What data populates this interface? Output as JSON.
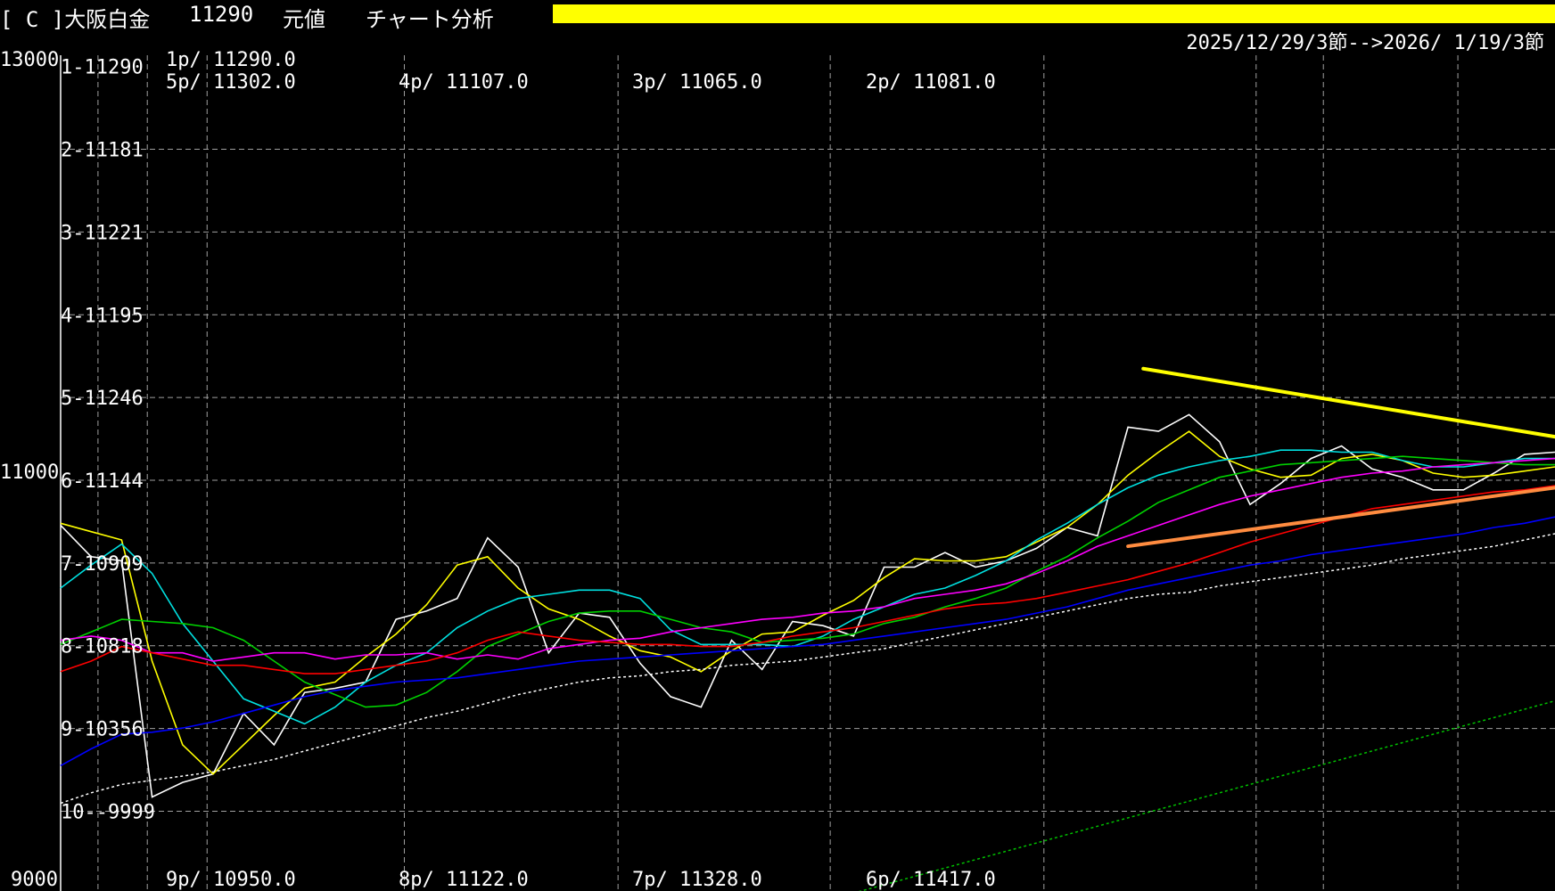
{
  "header": {
    "symbol": "[ C ]大阪白金",
    "price": "11290",
    "price_type": "元値",
    "mode": "チャート分析",
    "date_range": "2025/12/29/3節-->2026/ 1/19/3節"
  },
  "colors": {
    "background": "#000000",
    "header_bar": "#ffff00",
    "grid": "#a0a0a0",
    "resistance_line": "#ffff00",
    "support_line": "#ff8c40"
  },
  "chart_data": {
    "type": "line",
    "y_axis_labels": [
      "13000",
      "11000",
      "9000"
    ],
    "ylim": [
      9000,
      13000
    ],
    "grid": true,
    "row_labels": [
      "1-11290",
      "2-11181",
      "3-11221",
      "4-11195",
      "5-11246",
      "6-11144",
      "7-10909",
      "8-10818",
      "9-10356",
      "10--9999"
    ],
    "period_labels": {
      "top_row1": [
        "1p/ 11290.0"
      ],
      "top_row2": [
        "5p/ 11302.0",
        "4p/ 11107.0",
        "3p/ 11065.0",
        "2p/ 11081.0"
      ],
      "bottom": [
        "9p/ 10950.0",
        "8p/ 11122.0",
        "7p/ 11328.0",
        "6p/ 11417.0"
      ]
    },
    "x_index": [
      0,
      1,
      2,
      3,
      4,
      5,
      6,
      7,
      8,
      9,
      10,
      11,
      12,
      13,
      14,
      15,
      16,
      17,
      18,
      19,
      20,
      21,
      22,
      23,
      24,
      25,
      26,
      27,
      28,
      29,
      30,
      31,
      32,
      33,
      34,
      35,
      36,
      37,
      38,
      39,
      40,
      41,
      42,
      43,
      44,
      45,
      46,
      47,
      48,
      49
    ],
    "series": [
      {
        "color": "#ffffff",
        "style": "solid",
        "values": [
          10750,
          10600,
          10580,
          9450,
          9520,
          9560,
          9850,
          9700,
          9950,
          9970,
          10000,
          10300,
          10340,
          10400,
          10690,
          10550,
          10140,
          10330,
          10310,
          10090,
          9930,
          9880,
          10200,
          10060,
          10290,
          10270,
          10220,
          10550,
          10550,
          10620,
          10550,
          10580,
          10640,
          10740,
          10700,
          11220,
          11200,
          11280,
          11150,
          10850,
          10950,
          11070,
          11130,
          11020,
          10980,
          10920,
          10920,
          11000,
          11090,
          11100
        ]
      },
      {
        "color": "#ffff00",
        "style": "solid",
        "values": [
          10760,
          10720,
          10680,
          10100,
          9700,
          9560,
          9700,
          9840,
          9970,
          10000,
          10120,
          10230,
          10370,
          10560,
          10600,
          10450,
          10350,
          10300,
          10220,
          10150,
          10120,
          10050,
          10150,
          10230,
          10240,
          10320,
          10390,
          10500,
          10590,
          10580,
          10580,
          10600,
          10670,
          10740,
          10850,
          10990,
          11100,
          11200,
          11080,
          11020,
          10980,
          10990,
          11070,
          11090,
          11060,
          11000,
          10980,
          10990,
          11010,
          11030
        ]
      },
      {
        "color": "#00e0e0",
        "style": "solid",
        "values": [
          10450,
          10560,
          10660,
          10520,
          10280,
          10100,
          9920,
          9860,
          9800,
          9880,
          10000,
          10080,
          10140,
          10260,
          10340,
          10400,
          10420,
          10440,
          10440,
          10400,
          10250,
          10180,
          10180,
          10180,
          10170,
          10220,
          10300,
          10360,
          10420,
          10450,
          10510,
          10580,
          10680,
          10760,
          10850,
          10930,
          10990,
          11030,
          11060,
          11080,
          11110,
          11110,
          11100,
          11100,
          11060,
          11030,
          11030,
          11050,
          11070,
          11070
        ]
      },
      {
        "color": "#00d000",
        "style": "solid",
        "values": [
          10180,
          10240,
          10300,
          10290,
          10280,
          10260,
          10200,
          10100,
          10000,
          9940,
          9880,
          9890,
          9950,
          10050,
          10170,
          10230,
          10290,
          10330,
          10340,
          10340,
          10300,
          10260,
          10240,
          10190,
          10200,
          10210,
          10230,
          10280,
          10310,
          10360,
          10400,
          10450,
          10530,
          10600,
          10690,
          10770,
          10860,
          10920,
          10980,
          11010,
          11040,
          11050,
          11060,
          11070,
          11080,
          11070,
          11060,
          11050,
          11040,
          11040
        ]
      },
      {
        "color": "#ff00ff",
        "style": "solid",
        "values": [
          10200,
          10220,
          10200,
          10140,
          10140,
          10100,
          10120,
          10140,
          10140,
          10110,
          10130,
          10130,
          10140,
          10110,
          10130,
          10110,
          10160,
          10180,
          10200,
          10210,
          10240,
          10260,
          10280,
          10300,
          10310,
          10330,
          10340,
          10360,
          10400,
          10420,
          10440,
          10470,
          10520,
          10580,
          10650,
          10700,
          10750,
          10800,
          10850,
          10890,
          10920,
          10950,
          10980,
          11000,
          11010,
          11030,
          11040,
          11050,
          11060,
          11070
        ]
      },
      {
        "color": "#ff0000",
        "style": "solid",
        "values": [
          10050,
          10100,
          10170,
          10140,
          10110,
          10080,
          10080,
          10060,
          10040,
          10040,
          10060,
          10080,
          10100,
          10140,
          10200,
          10240,
          10220,
          10200,
          10190,
          10180,
          10180,
          10170,
          10170,
          10190,
          10220,
          10240,
          10260,
          10290,
          10320,
          10350,
          10370,
          10380,
          10400,
          10430,
          10460,
          10490,
          10530,
          10570,
          10620,
          10670,
          10710,
          10750,
          10790,
          10830,
          10850,
          10870,
          10890,
          10910,
          10920,
          10940
        ]
      },
      {
        "color": "#0000ff",
        "style": "solid",
        "values": [
          9600,
          9680,
          9750,
          9760,
          9780,
          9810,
          9850,
          9890,
          9930,
          9960,
          9980,
          10000,
          10010,
          10020,
          10040,
          10060,
          10080,
          10100,
          10110,
          10120,
          10130,
          10140,
          10150,
          10160,
          10170,
          10180,
          10200,
          10220,
          10240,
          10260,
          10280,
          10300,
          10330,
          10360,
          10400,
          10440,
          10470,
          10500,
          10530,
          10560,
          10580,
          10610,
          10630,
          10650,
          10670,
          10690,
          10710,
          10740,
          10760,
          10790
        ]
      },
      {
        "color": "#ffffff",
        "style": "dotted",
        "values": [
          9420,
          9470,
          9510,
          9530,
          9550,
          9570,
          9600,
          9630,
          9670,
          9710,
          9750,
          9790,
          9830,
          9860,
          9900,
          9940,
          9970,
          10000,
          10020,
          10030,
          10050,
          10060,
          10080,
          10090,
          10100,
          10120,
          10140,
          10160,
          10190,
          10220,
          10250,
          10280,
          10310,
          10340,
          10370,
          10400,
          10420,
          10430,
          10460,
          10480,
          10500,
          10520,
          10540,
          10560,
          10590,
          10610,
          10630,
          10650,
          10680,
          10710
        ]
      },
      {
        "color": "#00c000",
        "style": "dotted",
        "start_index": 20,
        "values": [
          8800,
          8830,
          8860,
          8890,
          8920,
          8950,
          8990,
          9030,
          9070,
          9110,
          9150,
          9190,
          9230,
          9270,
          9310,
          9350,
          9390,
          9430,
          9470,
          9510,
          9550,
          9590,
          9630,
          9670,
          9710,
          9750,
          9790,
          9830,
          9870,
          9910
        ]
      }
    ],
    "trendlines": [
      {
        "name": "resistance",
        "color": "#ffff00",
        "start": [
          35.5,
          11500
        ],
        "end": [
          50,
          11150
        ]
      },
      {
        "name": "support",
        "color": "#ff8c40",
        "start": [
          35,
          10650
        ],
        "end": [
          50,
          10950
        ]
      }
    ]
  }
}
